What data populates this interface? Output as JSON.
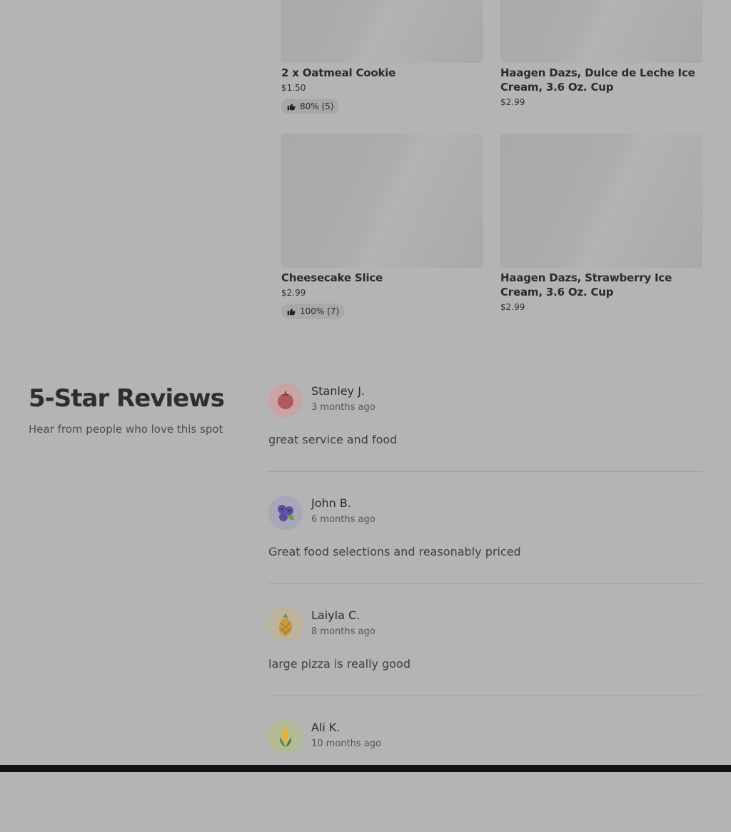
{
  "menu_items": [
    {
      "name": "2 x Oatmeal Cookie",
      "price": "$1.50",
      "rating": "80% (5)"
    },
    {
      "name": "Haagen Dazs, Dulce de Leche Ice Cream, 3.6 Oz. Cup",
      "price": "$2.99",
      "rating": null
    },
    {
      "name": "Cheesecake Slice",
      "price": "$2.99",
      "rating": "100% (7)"
    },
    {
      "name": "Haagen Dazs, Strawberry Ice Cream, 3.6 Oz. Cup",
      "price": "$2.99",
      "rating": null
    }
  ],
  "reviews_section": {
    "title": "5-Star Reviews",
    "subtitle": "Hear from people who love this spot"
  },
  "reviews": [
    {
      "author": "Stanley J.",
      "time": "3 months ago",
      "text": "great service and food",
      "avatar_icon": "apple-icon",
      "avatar_bg": "#c9a4a4"
    },
    {
      "author": "John B.",
      "time": "6 months ago",
      "text": "Great food selections and reasonably priced",
      "avatar_icon": "blueberry-icon",
      "avatar_bg": "#a9a6b8"
    },
    {
      "author": "Laiyla C.",
      "time": "8 months ago",
      "text": "large pizza is really good",
      "avatar_icon": "pineapple-icon",
      "avatar_bg": "#bfb29a"
    },
    {
      "author": "Ali K.",
      "time": "10 months ago",
      "text": "",
      "avatar_icon": "corn-icon",
      "avatar_bg": "#b3bb95"
    }
  ]
}
